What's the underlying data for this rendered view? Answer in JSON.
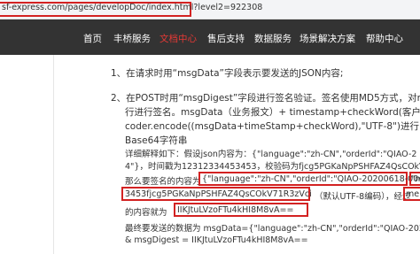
{
  "browser": {
    "url": "sf-express.com/pages/developDoc/index.html?level2=922308"
  },
  "nav": {
    "items": [
      {
        "label": "首页"
      },
      {
        "label": "丰桥服务"
      },
      {
        "label": "文档中心"
      },
      {
        "label": "售后支持"
      },
      {
        "label": "数据服务"
      },
      {
        "label": "场景解决方案"
      },
      {
        "label": "帮助中心"
      }
    ],
    "active_index": 2,
    "active_color": "#e53935",
    "background": "#333333"
  },
  "doc": {
    "l1": "1、在请求时用“msgData”字段表示要发送的JSON内容;",
    "l2": "2、在POST时用“msgDigest”字段进行签名验证。签名使用MD5方式，对m",
    "l3": "行进行签名。msgData（业务报文）+ timestamp+checkWord(客户校验码)",
    "l4": "coder.encode((msgData+timeStamp+checkWord),\"UTF-8\")进行MD5，",
    "l5": "Base64字符串",
    "l6": "详细解释如下：假设json内容为：{\"language\":\"zh-CN\",\"orderId\":\"QIAO-2",
    "l7": "4\"}，时间戳为12312334453453，校验码为fjcg5PGKaNpPSHFAZ4QsCOkV",
    "l8a": "那么要签名的内容为",
    "l8b": "{\"language\":\"zh-CN\",\"orderId\":\"QIAO-20200618-004\"",
    "l8c": "\"m",
    "l9a": "3453fjcg5PGKaNpPSHFAZ4QsCOkV71R3zVci",
    "l9b": "（默认UTF-8编码），经过",
    "l9c": "me",
    "l10a": "的内容就为",
    "l10b": "IIKJtuLVzoFTu4kHI8M8vA==",
    "l11": "最终要发送的数据为 msgData={\"language\":\"zh-CN\",\"orderId\":\"QIAO-2020",
    "l12": "& msgDigest = IIKJtuLVzoFTu4kHI8M8vA=="
  },
  "colors": {
    "highlight_border": "#d32222",
    "text": "#333333"
  }
}
